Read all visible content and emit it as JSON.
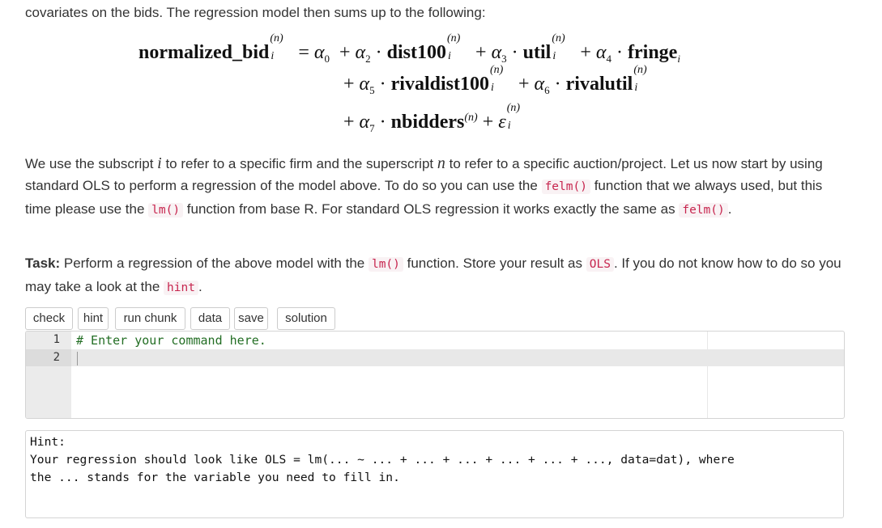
{
  "intro_line": "covariates on the bids. The regression model then sums up to the following:",
  "equation": {
    "lhs": "normalized_bid",
    "lhs_sub": "i",
    "sup": "(n)",
    "eq": "=",
    "plus": "+",
    "dot": "·",
    "alpha": "α",
    "epsilon": "ε",
    "a0_sub": "0",
    "a2_sub": "2",
    "a3_sub": "3",
    "a4_sub": "4",
    "a5_sub": "5",
    "a6_sub": "6",
    "a7_sub": "7",
    "var_dist": "dist100",
    "var_util": "util",
    "var_fringe": "fringe",
    "var_rivaldist": "rivaldist100",
    "var_rivalutil": "rivalutil",
    "var_nbidders": "nbidders",
    "idx": "i"
  },
  "para1": {
    "t1": "We use the subscript ",
    "var_i": "i",
    "t2": " to refer to a specific firm and the superscript ",
    "var_n": "n",
    "t3": " to refer to a specific auction/project. Let us now start by using standard OLS to perform a regression of the model above. To do so you can use the ",
    "code1": "felm()",
    "t4": " function that we always used, but this time please use the ",
    "code2": "lm()",
    "t5": " function from base R. For standard OLS regression it works exactly the same as ",
    "code3": "felm()",
    "t6": "."
  },
  "task": {
    "label": "Task:",
    "t1": " Perform a regression of the above model with the ",
    "code1": "lm()",
    "t2": " function. Store your result as ",
    "code2": "OLS",
    "t3": ". If you do not know how to do so you may take a look at the ",
    "code3": "hint",
    "t4": "."
  },
  "toolbar": {
    "check": "check",
    "hint": "hint",
    "run_chunk": "run chunk",
    "data": "data",
    "save": "save",
    "solution": "solution"
  },
  "editor": {
    "line_numbers": [
      "1",
      "2"
    ],
    "line1": "# Enter your command here.",
    "line2": ""
  },
  "hint_box": {
    "title": "Hint:",
    "line1": "Your regression should look like OLS = lm(... ~ ... + ... + ... + ... + ... + ..., data=dat), where",
    "line2": "the ... stands for the variable you need to fill in."
  },
  "colors": {
    "code_text": "#c7254e",
    "code_bg": "#f9f2f4",
    "comment": "#236e24",
    "gutter_bg": "#ebebeb"
  }
}
